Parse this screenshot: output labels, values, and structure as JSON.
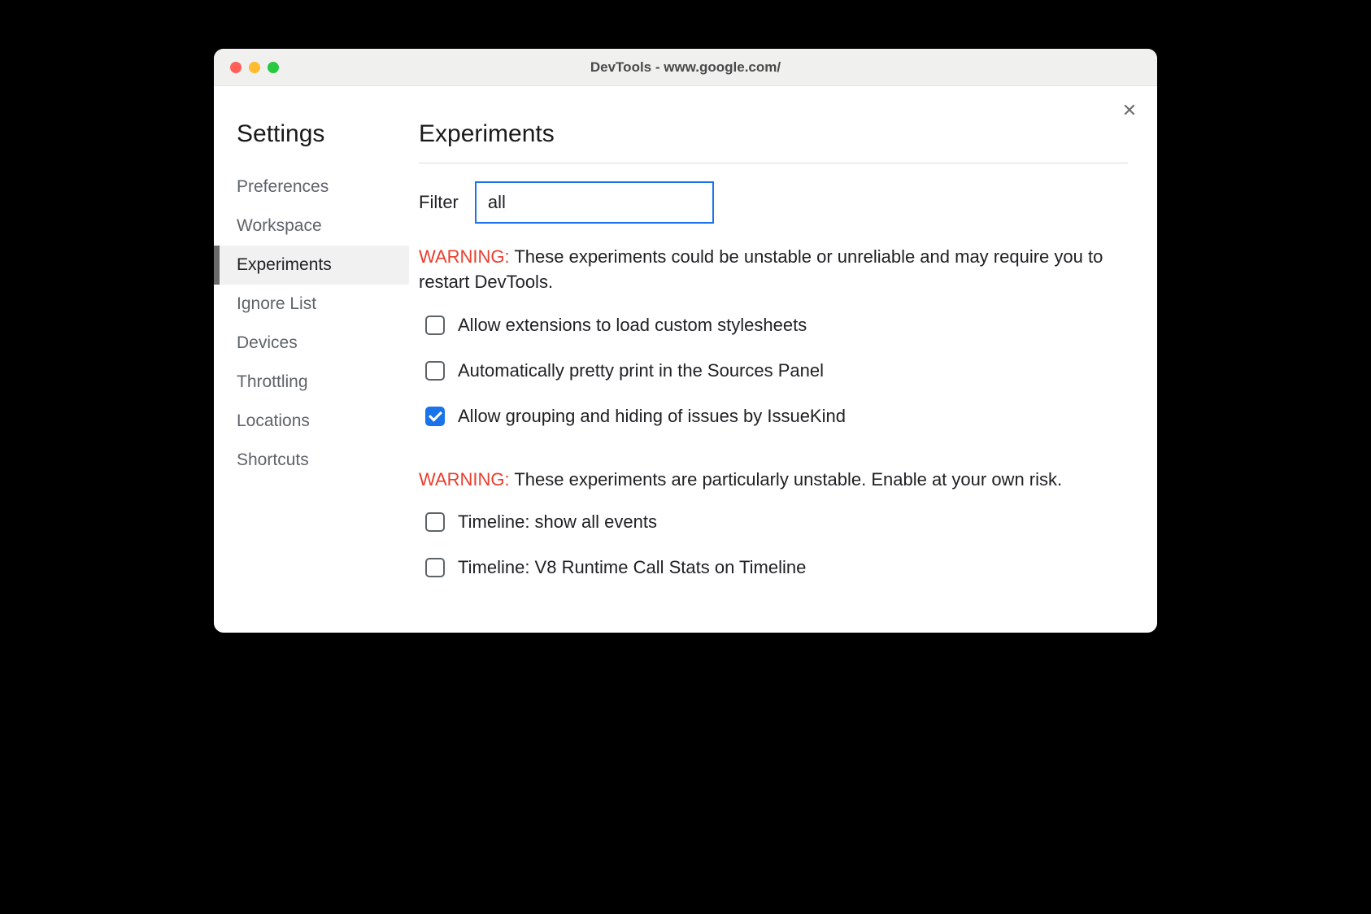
{
  "window": {
    "title": "DevTools - www.google.com/"
  },
  "sidebar": {
    "title": "Settings",
    "items": [
      {
        "label": "Preferences",
        "selected": false
      },
      {
        "label": "Workspace",
        "selected": false
      },
      {
        "label": "Experiments",
        "selected": true
      },
      {
        "label": "Ignore List",
        "selected": false
      },
      {
        "label": "Devices",
        "selected": false
      },
      {
        "label": "Throttling",
        "selected": false
      },
      {
        "label": "Locations",
        "selected": false
      },
      {
        "label": "Shortcuts",
        "selected": false
      }
    ]
  },
  "main": {
    "title": "Experiments",
    "filter": {
      "label": "Filter",
      "value": "all"
    },
    "warning1": {
      "prefix": "WARNING:",
      "text": " These experiments could be unstable or unreliable and may require you to restart DevTools."
    },
    "experiments1": [
      {
        "label": "Allow extensions to load custom stylesheets",
        "checked": false
      },
      {
        "label": "Automatically pretty print in the Sources Panel",
        "checked": false
      },
      {
        "label": "Allow grouping and hiding of issues by IssueKind",
        "checked": true
      }
    ],
    "warning2": {
      "prefix": "WARNING:",
      "text": " These experiments are particularly unstable. Enable at your own risk."
    },
    "experiments2": [
      {
        "label": "Timeline: show all events",
        "checked": false
      },
      {
        "label": "Timeline: V8 Runtime Call Stats on Timeline",
        "checked": false
      }
    ]
  }
}
